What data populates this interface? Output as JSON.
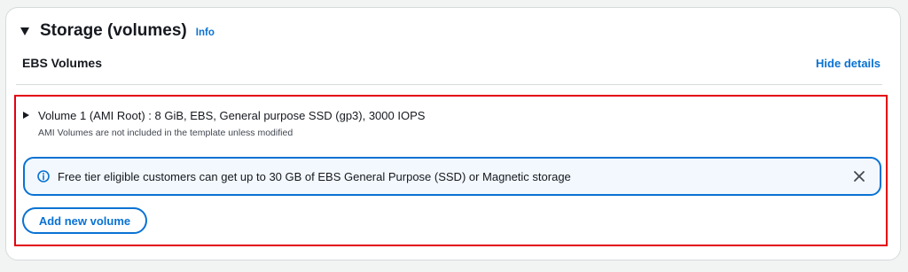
{
  "panel": {
    "title": "Storage (volumes)",
    "info_link": "Info",
    "section_title": "EBS Volumes",
    "hide_details_link": "Hide details"
  },
  "volume": {
    "summary": "Volume 1 (AMI Root) : 8 GiB, EBS, General purpose SSD (gp3), 3000 IOPS",
    "note": "AMI Volumes are not included in the template unless modified"
  },
  "alert": {
    "text": "Free tier eligible customers can get up to 30 GB of EBS General Purpose (SSD) or Magnetic storage",
    "icon": "info-icon",
    "dismiss_icon": "close-icon"
  },
  "actions": {
    "add_volume_label": "Add new volume"
  },
  "colors": {
    "link": "#0972d3",
    "alert_bg": "#f2f8fd",
    "highlight_border": "#e3000f",
    "text": "#16191f"
  }
}
